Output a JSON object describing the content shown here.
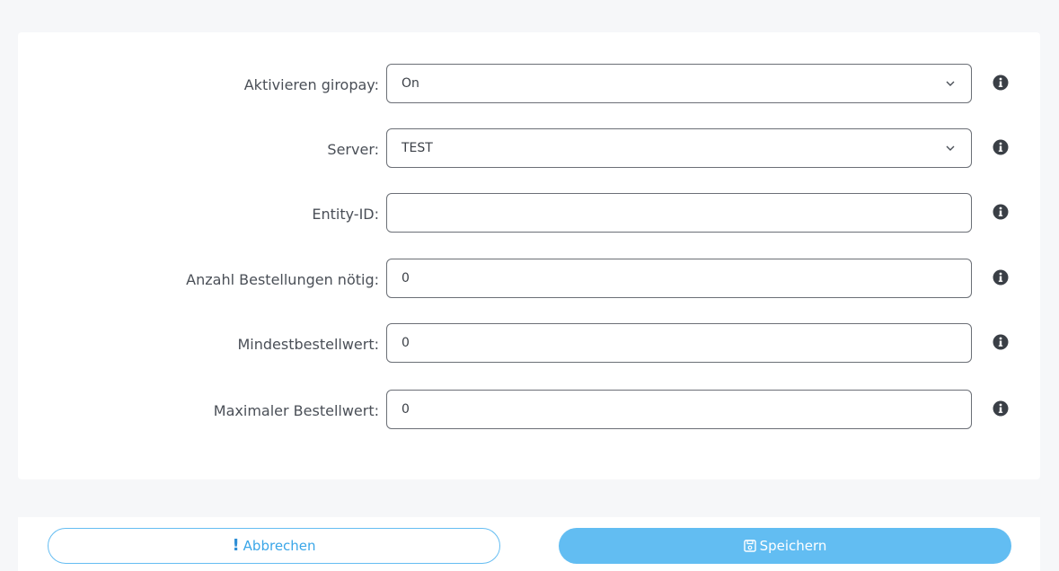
{
  "form": {
    "fields": [
      {
        "label": "Aktivieren giropay:",
        "type": "select",
        "value": "On"
      },
      {
        "label": "Server:",
        "type": "select",
        "value": "TEST"
      },
      {
        "label": "Entity-ID:",
        "type": "input",
        "value": ""
      },
      {
        "label": "Anzahl Bestellungen nötig:",
        "type": "input",
        "value": "0"
      },
      {
        "label": "Mindestbestellwert:",
        "type": "input",
        "value": "0"
      },
      {
        "label": "Maximaler Bestellwert:",
        "type": "input",
        "value": "0"
      }
    ]
  },
  "actions": {
    "cancel_label": "Abbrechen",
    "save_label": "Speichern"
  },
  "icons": {
    "info": "info-circle-icon",
    "chevron": "chevron-down-icon",
    "cancel": "exclamation-icon",
    "save": "floppy-disk-icon"
  },
  "colors": {
    "accent": "#62bdf2",
    "info_icon": "#3a3f46"
  }
}
